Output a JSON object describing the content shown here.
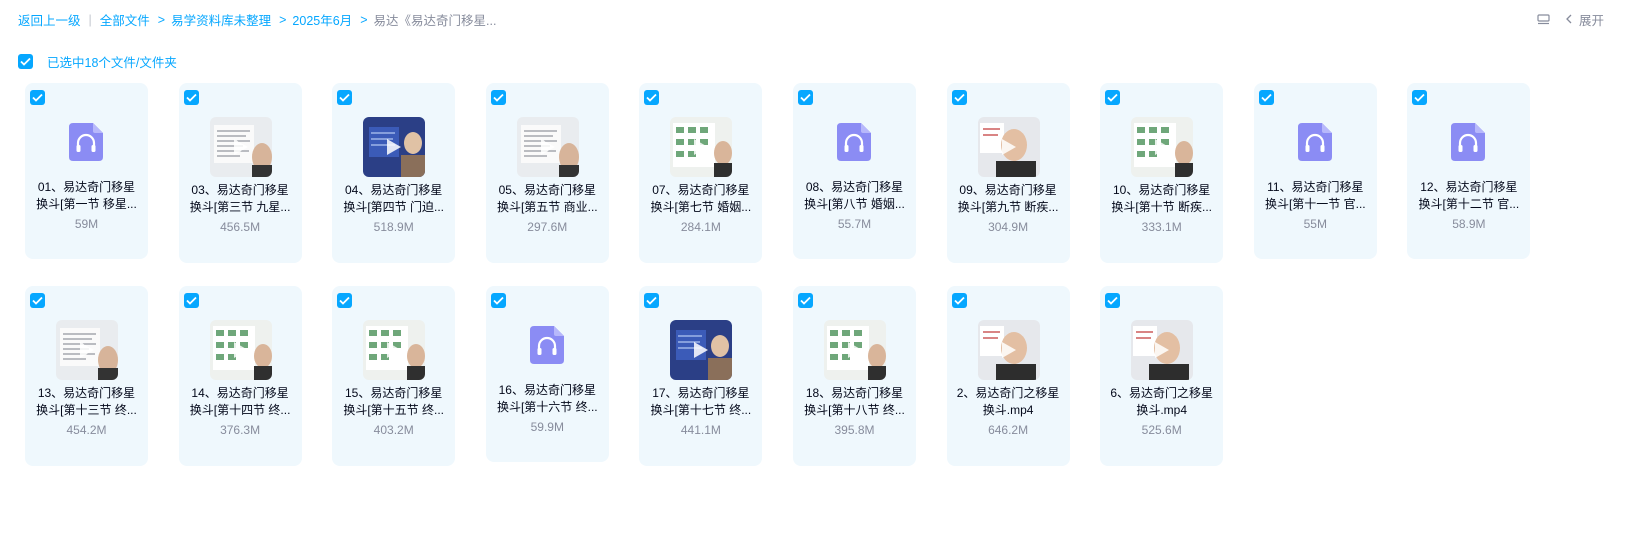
{
  "breadcrumb": {
    "back": "返回上一级",
    "all_files": "全部文件",
    "folder1": "易学资料库未整理",
    "folder2": "2025年6月",
    "current": "易达《易达奇门移星..."
  },
  "toolbar": {
    "expand_label": "展开"
  },
  "selection": {
    "label": "已选中18个文件/文件夹"
  },
  "colors": {
    "accent": "#06a7ff",
    "card_bg": "#eff8fd",
    "audio_icon": "#8b8cf4"
  },
  "files": [
    {
      "line1": "01、易达奇门移星",
      "line2": "换斗[第一节 移星...",
      "size": "59M",
      "type": "audio"
    },
    {
      "line1": "03、易达奇门移星",
      "line2": "换斗[第三节 九星...",
      "size": "456.5M",
      "type": "video",
      "theme": "whiteboard"
    },
    {
      "line1": "04、易达奇门移星",
      "line2": "换斗[第四节 门迫...",
      "size": "518.9M",
      "type": "video",
      "theme": "blue"
    },
    {
      "line1": "05、易达奇门移星",
      "line2": "换斗[第五节 商业...",
      "size": "297.6M",
      "type": "video",
      "theme": "whiteboard"
    },
    {
      "line1": "07、易达奇门移星",
      "line2": "换斗[第七节 婚姻...",
      "size": "284.1M",
      "type": "video",
      "theme": "chart"
    },
    {
      "line1": "08、易达奇门移星",
      "line2": "换斗[第八节 婚姻...",
      "size": "55.7M",
      "type": "audio"
    },
    {
      "line1": "09、易达奇门移星",
      "line2": "换斗[第九节 断疾...",
      "size": "304.9M",
      "type": "video",
      "theme": "face"
    },
    {
      "line1": "10、易达奇门移星",
      "line2": "换斗[第十节 断疾...",
      "size": "333.1M",
      "type": "video",
      "theme": "chart"
    },
    {
      "line1": "11、易达奇门移星",
      "line2": "换斗[第十一节 官...",
      "size": "55M",
      "type": "audio"
    },
    {
      "line1": "12、易达奇门移星",
      "line2": "换斗[第十二节 官...",
      "size": "58.9M",
      "type": "audio"
    },
    {
      "line1": "13、易达奇门移星",
      "line2": "换斗[第十三节 终...",
      "size": "454.2M",
      "type": "video",
      "theme": "whiteboard"
    },
    {
      "line1": "14、易达奇门移星",
      "line2": "换斗[第十四节 终...",
      "size": "376.3M",
      "type": "video",
      "theme": "chart"
    },
    {
      "line1": "15、易达奇门移星",
      "line2": "换斗[第十五节 终...",
      "size": "403.2M",
      "type": "video",
      "theme": "chart"
    },
    {
      "line1": "16、易达奇门移星",
      "line2": "换斗[第十六节 终...",
      "size": "59.9M",
      "type": "audio"
    },
    {
      "line1": "17、易达奇门移星",
      "line2": "换斗[第十七节 终...",
      "size": "441.1M",
      "type": "video",
      "theme": "blue"
    },
    {
      "line1": "18、易达奇门移星",
      "line2": "换斗[第十八节 终...",
      "size": "395.8M",
      "type": "video",
      "theme": "chart"
    },
    {
      "line1": "2、易达奇门之移星",
      "line2": "换斗.mp4",
      "size": "646.2M",
      "type": "video",
      "theme": "face"
    },
    {
      "line1": "6、易达奇门之移星",
      "line2": "换斗.mp4",
      "size": "525.6M",
      "type": "video",
      "theme": "face"
    }
  ]
}
